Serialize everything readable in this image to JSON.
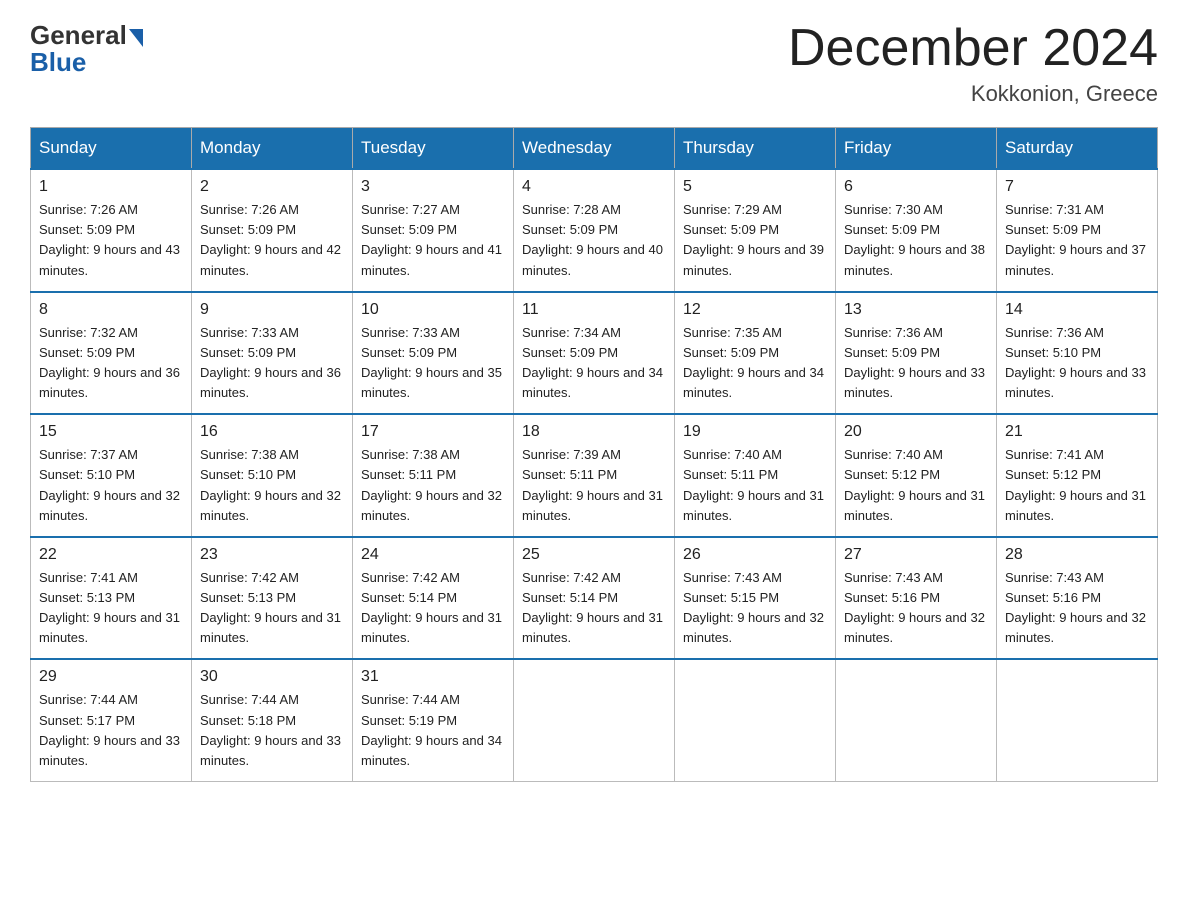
{
  "logo": {
    "general": "General",
    "blue": "Blue"
  },
  "title": "December 2024",
  "location": "Kokkonion, Greece",
  "days_of_week": [
    "Sunday",
    "Monday",
    "Tuesday",
    "Wednesday",
    "Thursday",
    "Friday",
    "Saturday"
  ],
  "weeks": [
    [
      {
        "day": "1",
        "sunrise": "7:26 AM",
        "sunset": "5:09 PM",
        "daylight": "9 hours and 43 minutes."
      },
      {
        "day": "2",
        "sunrise": "7:26 AM",
        "sunset": "5:09 PM",
        "daylight": "9 hours and 42 minutes."
      },
      {
        "day": "3",
        "sunrise": "7:27 AM",
        "sunset": "5:09 PM",
        "daylight": "9 hours and 41 minutes."
      },
      {
        "day": "4",
        "sunrise": "7:28 AM",
        "sunset": "5:09 PM",
        "daylight": "9 hours and 40 minutes."
      },
      {
        "day": "5",
        "sunrise": "7:29 AM",
        "sunset": "5:09 PM",
        "daylight": "9 hours and 39 minutes."
      },
      {
        "day": "6",
        "sunrise": "7:30 AM",
        "sunset": "5:09 PM",
        "daylight": "9 hours and 38 minutes."
      },
      {
        "day": "7",
        "sunrise": "7:31 AM",
        "sunset": "5:09 PM",
        "daylight": "9 hours and 37 minutes."
      }
    ],
    [
      {
        "day": "8",
        "sunrise": "7:32 AM",
        "sunset": "5:09 PM",
        "daylight": "9 hours and 36 minutes."
      },
      {
        "day": "9",
        "sunrise": "7:33 AM",
        "sunset": "5:09 PM",
        "daylight": "9 hours and 36 minutes."
      },
      {
        "day": "10",
        "sunrise": "7:33 AM",
        "sunset": "5:09 PM",
        "daylight": "9 hours and 35 minutes."
      },
      {
        "day": "11",
        "sunrise": "7:34 AM",
        "sunset": "5:09 PM",
        "daylight": "9 hours and 34 minutes."
      },
      {
        "day": "12",
        "sunrise": "7:35 AM",
        "sunset": "5:09 PM",
        "daylight": "9 hours and 34 minutes."
      },
      {
        "day": "13",
        "sunrise": "7:36 AM",
        "sunset": "5:09 PM",
        "daylight": "9 hours and 33 minutes."
      },
      {
        "day": "14",
        "sunrise": "7:36 AM",
        "sunset": "5:10 PM",
        "daylight": "9 hours and 33 minutes."
      }
    ],
    [
      {
        "day": "15",
        "sunrise": "7:37 AM",
        "sunset": "5:10 PM",
        "daylight": "9 hours and 32 minutes."
      },
      {
        "day": "16",
        "sunrise": "7:38 AM",
        "sunset": "5:10 PM",
        "daylight": "9 hours and 32 minutes."
      },
      {
        "day": "17",
        "sunrise": "7:38 AM",
        "sunset": "5:11 PM",
        "daylight": "9 hours and 32 minutes."
      },
      {
        "day": "18",
        "sunrise": "7:39 AM",
        "sunset": "5:11 PM",
        "daylight": "9 hours and 31 minutes."
      },
      {
        "day": "19",
        "sunrise": "7:40 AM",
        "sunset": "5:11 PM",
        "daylight": "9 hours and 31 minutes."
      },
      {
        "day": "20",
        "sunrise": "7:40 AM",
        "sunset": "5:12 PM",
        "daylight": "9 hours and 31 minutes."
      },
      {
        "day": "21",
        "sunrise": "7:41 AM",
        "sunset": "5:12 PM",
        "daylight": "9 hours and 31 minutes."
      }
    ],
    [
      {
        "day": "22",
        "sunrise": "7:41 AM",
        "sunset": "5:13 PM",
        "daylight": "9 hours and 31 minutes."
      },
      {
        "day": "23",
        "sunrise": "7:42 AM",
        "sunset": "5:13 PM",
        "daylight": "9 hours and 31 minutes."
      },
      {
        "day": "24",
        "sunrise": "7:42 AM",
        "sunset": "5:14 PM",
        "daylight": "9 hours and 31 minutes."
      },
      {
        "day": "25",
        "sunrise": "7:42 AM",
        "sunset": "5:14 PM",
        "daylight": "9 hours and 31 minutes."
      },
      {
        "day": "26",
        "sunrise": "7:43 AM",
        "sunset": "5:15 PM",
        "daylight": "9 hours and 32 minutes."
      },
      {
        "day": "27",
        "sunrise": "7:43 AM",
        "sunset": "5:16 PM",
        "daylight": "9 hours and 32 minutes."
      },
      {
        "day": "28",
        "sunrise": "7:43 AM",
        "sunset": "5:16 PM",
        "daylight": "9 hours and 32 minutes."
      }
    ],
    [
      {
        "day": "29",
        "sunrise": "7:44 AM",
        "sunset": "5:17 PM",
        "daylight": "9 hours and 33 minutes."
      },
      {
        "day": "30",
        "sunrise": "7:44 AM",
        "sunset": "5:18 PM",
        "daylight": "9 hours and 33 minutes."
      },
      {
        "day": "31",
        "sunrise": "7:44 AM",
        "sunset": "5:19 PM",
        "daylight": "9 hours and 34 minutes."
      },
      null,
      null,
      null,
      null
    ]
  ]
}
